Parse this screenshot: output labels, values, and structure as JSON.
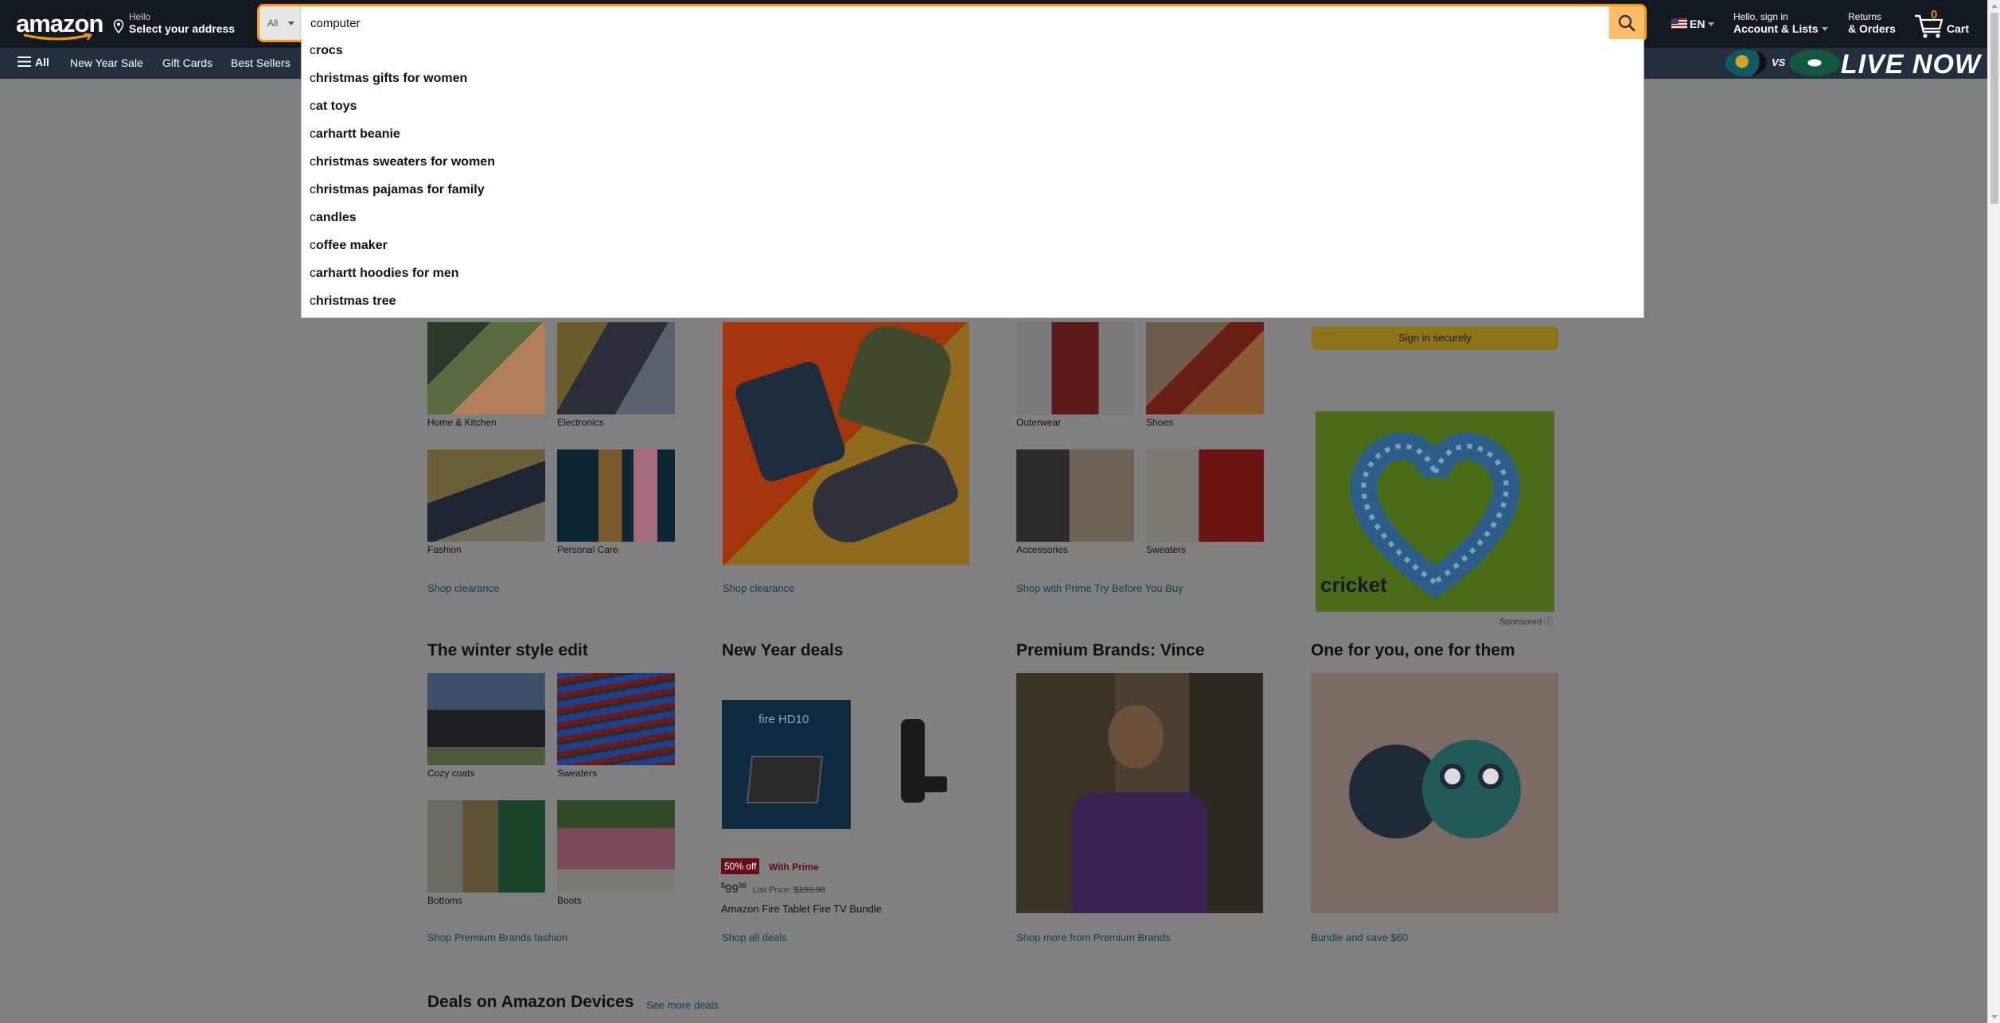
{
  "header": {
    "logo_text": "amazon",
    "address_line1": "Hello",
    "address_line2": "Select your address",
    "search_category": "All",
    "search_value": "computer",
    "language": "EN",
    "account_line1": "Hello, sign in",
    "account_line2": "Account & Lists",
    "returns_line1": "Returns",
    "returns_line2": "& Orders",
    "cart_count": "0",
    "cart_label": "Cart"
  },
  "nav": {
    "all_label": "All",
    "items": [
      "New Year Sale",
      "Gift Cards",
      "Best Sellers"
    ],
    "banner_vs": "VS",
    "banner_live": "LIVE NOW"
  },
  "suggestions": [
    {
      "prefix": "c",
      "rest": "rocs"
    },
    {
      "prefix": "c",
      "rest": "hristmas gifts for women"
    },
    {
      "prefix": "c",
      "rest": "at toys"
    },
    {
      "prefix": "c",
      "rest": "arhartt beanie"
    },
    {
      "prefix": "c",
      "rest": "hristmas sweaters for women"
    },
    {
      "prefix": "c",
      "rest": "hristmas pajamas for family"
    },
    {
      "prefix": "c",
      "rest": "andles"
    },
    {
      "prefix": "c",
      "rest": "offee maker"
    },
    {
      "prefix": "c",
      "rest": "arhartt hoodies for men"
    },
    {
      "prefix": "c",
      "rest": "hristmas tree"
    }
  ],
  "cards_row1": {
    "card1": {
      "tiles": [
        "Home & Kitchen",
        "Electronics",
        "Fashion",
        "Personal Care"
      ],
      "link": "Shop clearance"
    },
    "card2": {
      "link": "Shop clearance"
    },
    "card3": {
      "tiles": [
        "Outerwear",
        "Shoes",
        "Accessories",
        "Sweaters"
      ],
      "link": "Shop with Prime Try Before You Buy"
    },
    "signin_button": "Sign in securely",
    "ad_brand": "cricket",
    "sponsored": "Sponsored"
  },
  "cards_row2": {
    "card1": {
      "title": "The winter style edit",
      "tiles": [
        "Cozy coats",
        "Sweaters",
        "Bottoms",
        "Boots"
      ],
      "link": "Shop Premium Brands fashion"
    },
    "card2": {
      "title": "New Year deals",
      "tablet_text": "fire HD10",
      "badge": "50% off",
      "prime": "With Prime",
      "price_dollars": "99",
      "price_cents": "98",
      "list_label": "List Price:",
      "list_price": "$199.98",
      "product": "Amazon Fire Tablet Fire TV Bundle",
      "link": "Shop all deals"
    },
    "card3": {
      "title": "Premium Brands: Vince",
      "link": "Shop more from Premium Brands"
    },
    "card4": {
      "title": "One for you, one for them",
      "link": "Bundle and save $60"
    }
  },
  "deals_row": {
    "title": "Deals on Amazon Devices",
    "link": "See more deals"
  }
}
